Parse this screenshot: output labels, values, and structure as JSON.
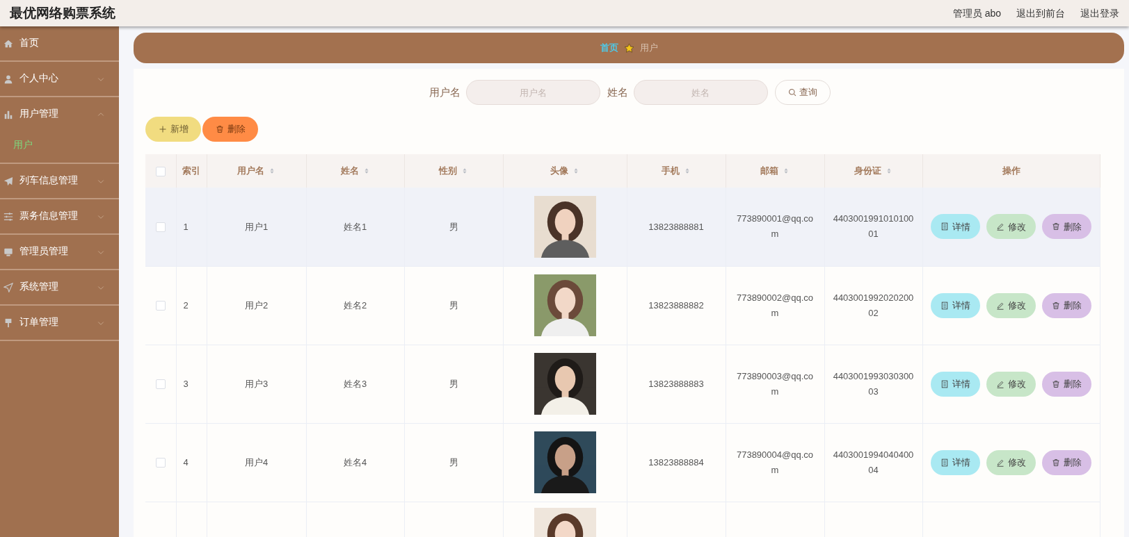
{
  "header": {
    "title": "最优网络购票系统",
    "links": [
      "管理员 abo",
      "退出到前台",
      "退出登录"
    ]
  },
  "sidebar": {
    "items": [
      {
        "label": "首页",
        "kind": "link"
      },
      {
        "label": "个人中心",
        "kind": "submenu",
        "expanded": false
      },
      {
        "label": "用户管理",
        "kind": "submenu",
        "expanded": true,
        "children": [
          {
            "label": "用户",
            "selected": true
          }
        ]
      },
      {
        "label": "列车信息管理",
        "kind": "submenu",
        "expanded": false
      },
      {
        "label": "票务信息管理",
        "kind": "submenu",
        "expanded": false
      },
      {
        "label": "管理员管理",
        "kind": "submenu",
        "expanded": false
      },
      {
        "label": "系统管理",
        "kind": "submenu",
        "expanded": false
      },
      {
        "label": "订单管理",
        "kind": "submenu",
        "expanded": false
      }
    ]
  },
  "breadcrumb": [
    "首页",
    "用户"
  ],
  "search": {
    "fields": [
      {
        "label": "用户名",
        "placeholder": "用户名"
      },
      {
        "label": "姓名",
        "placeholder": "姓名"
      }
    ],
    "button": "查询"
  },
  "actions": [
    {
      "label": "新增",
      "kind": "add"
    },
    {
      "label": "删除",
      "kind": "delete"
    }
  ],
  "table": {
    "select_all_checked": false,
    "columns": [
      {
        "label": "索引",
        "sortable": false
      },
      {
        "label": "用户名",
        "sortable": true
      },
      {
        "label": "姓名",
        "sortable": true
      },
      {
        "label": "性别",
        "sortable": true
      },
      {
        "label": "头像",
        "sortable": true
      },
      {
        "label": "手机",
        "sortable": true
      },
      {
        "label": "邮箱",
        "sortable": true
      },
      {
        "label": "身份证",
        "sortable": true
      },
      {
        "label": "操作",
        "sortable": false
      }
    ],
    "rows": [
      {
        "checked": false,
        "hovered": true,
        "index": "1",
        "username": "用户1",
        "name": "姓名1",
        "gender": "男",
        "avatar": {
          "kind": "picture"
        },
        "phone": "13823888881",
        "email": "773890001@qq.com",
        "id_card": "440300199101010001",
        "buttons": [
          "详情",
          "修改",
          "删除"
        ]
      },
      {
        "checked": false,
        "hovered": false,
        "index": "2",
        "username": "用户2",
        "name": "姓名2",
        "gender": "男",
        "avatar": {
          "kind": "picture"
        },
        "phone": "13823888882",
        "email": "773890002@qq.com",
        "id_card": "440300199202020002",
        "buttons": [
          "详情",
          "修改",
          "删除"
        ]
      },
      {
        "checked": false,
        "hovered": false,
        "index": "3",
        "username": "用户3",
        "name": "姓名3",
        "gender": "男",
        "avatar": {
          "kind": "picture"
        },
        "phone": "13823888883",
        "email": "773890003@qq.com",
        "id_card": "440300199303030003",
        "buttons": [
          "详情",
          "修改",
          "删除"
        ]
      },
      {
        "checked": false,
        "hovered": false,
        "index": "4",
        "username": "用户4",
        "name": "姓名4",
        "gender": "男",
        "avatar": {
          "kind": "picture"
        },
        "phone": "13823888884",
        "email": "773890004@qq.com",
        "id_card": "440300199404040004",
        "buttons": [
          "详情",
          "修改",
          "删除"
        ]
      },
      {
        "avatar": {
          "kind": "picture"
        }
      }
    ]
  }
}
